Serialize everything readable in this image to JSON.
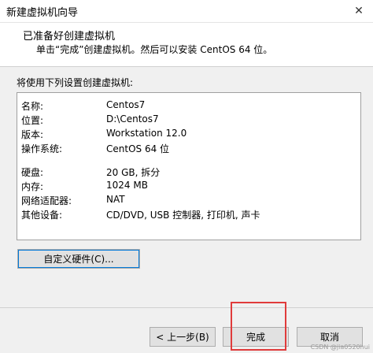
{
  "window": {
    "title": "新建虚拟机向导",
    "close_glyph": "✕"
  },
  "header": {
    "title": "已准备好创建虚拟机",
    "subtitle": "单击“完成”创建虚拟机。然后可以安装 CentOS 64 位。"
  },
  "summary": {
    "label": "将使用下列设置创建虚拟机:",
    "rows": [
      {
        "key": "名称:",
        "value": "Centos7"
      },
      {
        "key": "位置:",
        "value": "D:\\Centos7"
      },
      {
        "key": "版本:",
        "value": "Workstation 12.0"
      },
      {
        "key": "操作系统:",
        "value": "CentOS 64 位"
      },
      {
        "key": "硬盘:",
        "value": "20 GB, 拆分"
      },
      {
        "key": "内存:",
        "value": "1024 MB"
      },
      {
        "key": "网络适配器:",
        "value": "NAT"
      },
      {
        "key": "其他设备:",
        "value": "CD/DVD, USB 控制器, 打印机, 声卡"
      }
    ]
  },
  "buttons": {
    "customize": "自定义硬件(C)...",
    "back": "< 上一步(B)",
    "finish": "完成",
    "cancel": "取消"
  },
  "watermark": "CSDN @jia0520hui",
  "colors": {
    "highlight": "#e03b3b",
    "focus": "#0078d7"
  }
}
